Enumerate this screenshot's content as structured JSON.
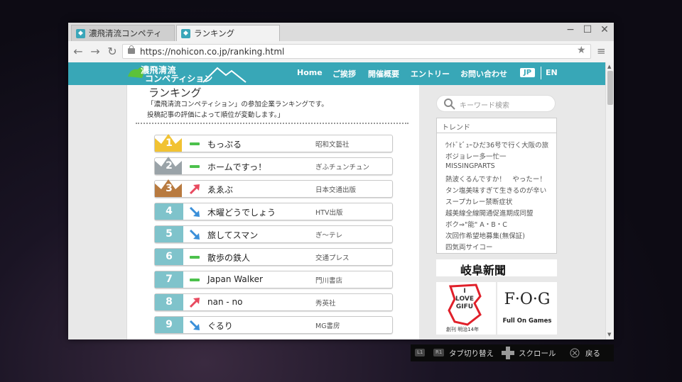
{
  "browser": {
    "tabs": [
      {
        "label": "濃飛清流コンペティション",
        "active": false
      },
      {
        "label": "ランキング",
        "active": true
      }
    ],
    "url": "https://nohicon.co.jp/ranking.html"
  },
  "site": {
    "logo": {
      "line1": "濃飛清流",
      "line2": "コンペティション"
    },
    "nav": [
      "Home",
      "ご挨拶",
      "開催概要",
      "エントリー",
      "お問い合わせ"
    ],
    "lang": {
      "jp": "JP",
      "en": "EN"
    }
  },
  "page": {
    "title": "ランキング",
    "description": [
      "「濃飛清流コンペティション」の参加企業ランキングです。",
      "投稿記事の評価によって順位が変動します。」"
    ]
  },
  "ranking": [
    {
      "rank": "1",
      "name": "もっぷる",
      "publisher": "昭和文藝社",
      "trend": "same"
    },
    {
      "rank": "2",
      "name": "ホームですっ！",
      "publisher": "ぎふチュンチュン",
      "trend": "same"
    },
    {
      "rank": "3",
      "name": "ゑゑぶ",
      "publisher": "日本交通出版",
      "trend": "up"
    },
    {
      "rank": "4",
      "name": "木曜どうでしょう",
      "publisher": "HTV出版",
      "trend": "down"
    },
    {
      "rank": "5",
      "name": "旅してスマン",
      "publisher": "ぎ〜テレ",
      "trend": "down"
    },
    {
      "rank": "6",
      "name": "散歩の鉄人",
      "publisher": "交通プレス",
      "trend": "same"
    },
    {
      "rank": "7",
      "name": "Japan Walker",
      "publisher": "門川書店",
      "trend": "same"
    },
    {
      "rank": "8",
      "name": "nan - no",
      "publisher": "秀英社",
      "trend": "up"
    },
    {
      "rank": "9",
      "name": "ぐるり",
      "publisher": "MG書房",
      "trend": "down"
    }
  ],
  "sidebar": {
    "search_placeholder": "キーワード検索",
    "trend_title": "トレンド",
    "trends": [
      "ｳｲﾄﾞﾋﾞｭｰひだ36号で行く大阪の旅",
      "ボジョレー多一忙一",
      "MISSINGPARTS",
      "熱波くるんですか！　やったー！",
      "タン塩美味すぎて生きるのが辛い",
      "スープカレー禁断症状",
      "越美線全線開通促進期成同盟",
      "ボク⇒\"能\" A・B・C",
      "次回作希望地募集(無保証)",
      "四気両サイコー"
    ],
    "banner1": "岐阜新聞",
    "banner2": {
      "line1": "I",
      "line2": "LOVE",
      "line3": "GIFU",
      "caption": "創刊 明治14年"
    },
    "banner3": {
      "logo": "F·O·G",
      "caption": "Full On Games"
    }
  },
  "hints": {
    "l1": "L1",
    "r1": "R1",
    "tab_switch": "タブ切り替え",
    "scroll": "スクロール",
    "back": "戻る"
  },
  "colors": {
    "accent": "#38a7b7",
    "rank": "#7fc3cb",
    "gold": "#f1c232",
    "silver": "#9aa3a8",
    "bronze": "#b87a3f",
    "same": "#4cc14c",
    "up": "#e84a5f",
    "down": "#3a8fd9"
  }
}
